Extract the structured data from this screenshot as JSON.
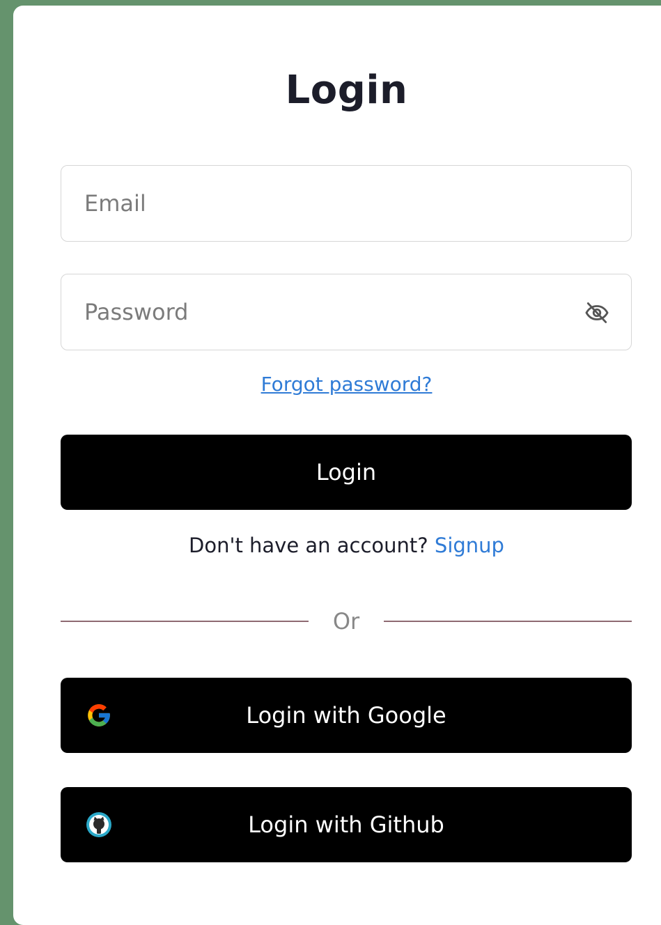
{
  "form": {
    "title": "Login",
    "email_placeholder": "Email",
    "password_placeholder": "Password",
    "forgot_password": "Forgot password?",
    "login_button": "Login",
    "no_account_text": "Don't have an account?",
    "signup_link": "Signup",
    "divider_text": "Or",
    "google_button": "Login with Google",
    "github_button": "Login with Github"
  },
  "icons": {
    "password_toggle": "eye-slash-icon",
    "google": "google-icon",
    "github": "github-icon"
  },
  "colors": {
    "page_background": "#65936d",
    "card_background": "#ffffff",
    "button_background": "#000000",
    "link": "#2f7bd6",
    "divider_line": "#8e6a72"
  }
}
